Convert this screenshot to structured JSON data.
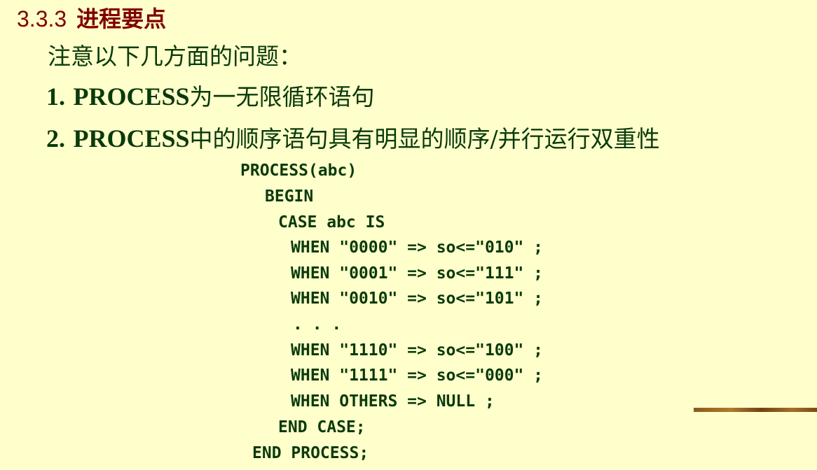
{
  "heading": {
    "number": "3.3.3",
    "text": "进程要点"
  },
  "intro": "注意以下几方面的问题：",
  "points": [
    {
      "num": "1.",
      "en": "PROCESS",
      "zh": "为一无限循环语句"
    },
    {
      "num": "2.",
      "en": "PROCESS",
      "zh": "中的顺序语句具有明显的顺序/并行运行双重性"
    }
  ],
  "code": [
    "PROCESS(abc)",
    "BEGIN",
    "CASE abc IS",
    "WHEN \"0000\" => so<=\"010\" ;",
    "WHEN \"0001\" => so<=\"111\" ;",
    "WHEN \"0010\" => so<=\"101\" ;",
    ". . .",
    "WHEN \"1110\" => so<=\"100\" ;",
    "WHEN \"1111\" => so<=\"000\" ;",
    "WHEN OTHERS => NULL ;",
    "END CASE;",
    "END PROCESS;"
  ]
}
